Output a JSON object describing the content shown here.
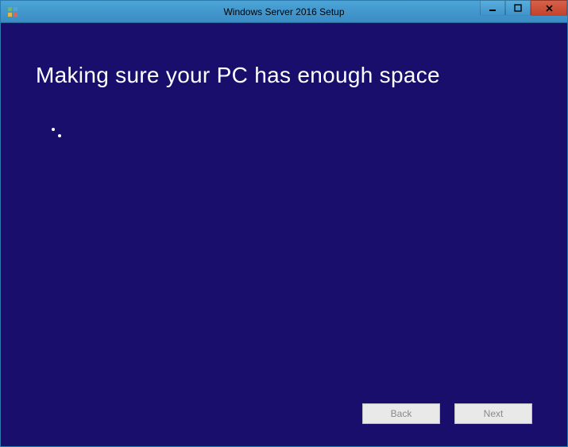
{
  "window": {
    "title": "Windows Server 2016 Setup"
  },
  "main": {
    "heading": "Making sure your PC has enough space"
  },
  "footer": {
    "back_label": "Back",
    "next_label": "Next"
  }
}
